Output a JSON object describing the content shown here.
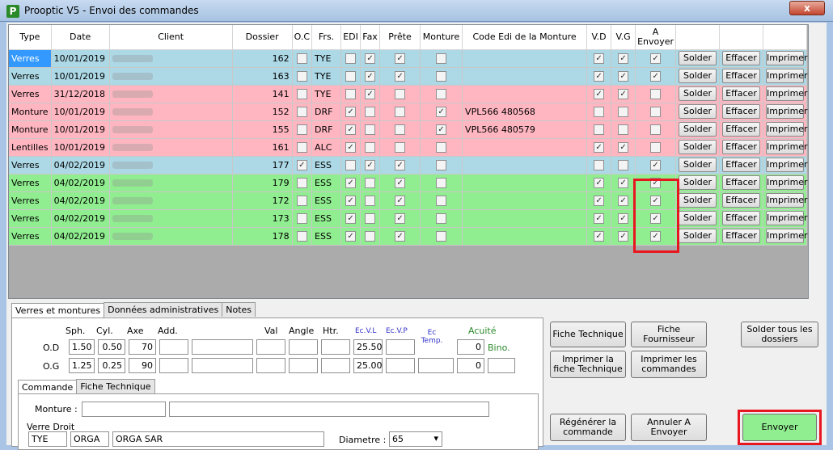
{
  "window": {
    "title": "Prooptic V5 - Envoi des commandes",
    "close": "x"
  },
  "columns": {
    "type": "Type",
    "date": "Date",
    "client": "Client",
    "dossier": "Dossier",
    "oc": "O.C",
    "frs": "Frs.",
    "edi": "EDI",
    "fax": "Fax",
    "prete": "Prête",
    "monture": "Monture",
    "code": "Code Edi de la Monture",
    "vd": "V.D",
    "vg": "V.G",
    "envoyer": "A Envoyer"
  },
  "buttons": {
    "solder": "Solder",
    "effacer": "Effacer",
    "imprimer": "Imprimer"
  },
  "rows": [
    {
      "color": "blue",
      "type": "Verres",
      "date": "10/01/2019",
      "dossier": "162",
      "oc": false,
      "frs": "TYE",
      "edi": false,
      "fax": true,
      "prete": true,
      "monture": false,
      "code": "",
      "vd": true,
      "vg": true,
      "env": true,
      "selected": true
    },
    {
      "color": "blue",
      "type": "Verres",
      "date": "10/01/2019",
      "dossier": "163",
      "oc": false,
      "frs": "TYE",
      "edi": false,
      "fax": true,
      "prete": true,
      "monture": false,
      "code": "",
      "vd": true,
      "vg": true,
      "env": true
    },
    {
      "color": "pink",
      "type": "Verres",
      "date": "31/12/2018",
      "dossier": "141",
      "oc": false,
      "frs": "TYE",
      "edi": false,
      "fax": true,
      "prete": false,
      "monture": false,
      "code": "",
      "vd": true,
      "vg": true,
      "env": false
    },
    {
      "color": "pink",
      "type": "Monture",
      "date": "10/01/2019",
      "dossier": "152",
      "oc": false,
      "frs": "DRF",
      "edi": true,
      "fax": false,
      "prete": false,
      "monture": true,
      "code": "VPL566 480568",
      "vd": false,
      "vg": false,
      "env": false
    },
    {
      "color": "pink",
      "type": "Monture",
      "date": "10/01/2019",
      "dossier": "155",
      "oc": false,
      "frs": "DRF",
      "edi": true,
      "fax": false,
      "prete": false,
      "monture": true,
      "code": "VPL566 480579",
      "vd": false,
      "vg": false,
      "env": false
    },
    {
      "color": "pink",
      "type": "Lentilles",
      "date": "10/01/2019",
      "dossier": "161",
      "oc": false,
      "frs": "ALC",
      "edi": true,
      "fax": false,
      "prete": false,
      "monture": false,
      "code": "",
      "vd": true,
      "vg": true,
      "env": false
    },
    {
      "color": "blue",
      "type": "Verres",
      "date": "04/02/2019",
      "dossier": "177",
      "oc": true,
      "frs": "ESS",
      "edi": false,
      "fax": true,
      "prete": true,
      "monture": false,
      "code": "",
      "vd": false,
      "vg": false,
      "env": true
    },
    {
      "color": "green",
      "type": "Verres",
      "date": "04/02/2019",
      "dossier": "179",
      "oc": false,
      "frs": "ESS",
      "edi": true,
      "fax": false,
      "prete": true,
      "monture": false,
      "code": "",
      "vd": true,
      "vg": true,
      "env": true
    },
    {
      "color": "green",
      "type": "Verres",
      "date": "04/02/2019",
      "dossier": "172",
      "oc": false,
      "frs": "ESS",
      "edi": true,
      "fax": false,
      "prete": true,
      "monture": false,
      "code": "",
      "vd": true,
      "vg": true,
      "env": true
    },
    {
      "color": "green",
      "type": "Verres",
      "date": "04/02/2019",
      "dossier": "173",
      "oc": false,
      "frs": "ESS",
      "edi": true,
      "fax": false,
      "prete": true,
      "monture": false,
      "code": "",
      "vd": true,
      "vg": true,
      "env": true
    },
    {
      "color": "green",
      "type": "Verres",
      "date": "04/02/2019",
      "dossier": "178",
      "oc": false,
      "frs": "ESS",
      "edi": true,
      "fax": false,
      "prete": true,
      "monture": false,
      "code": "",
      "vd": true,
      "vg": true,
      "env": true
    }
  ],
  "tabs": {
    "verres": "Verres et montures",
    "admin": "Données administratives",
    "notes": "Notes"
  },
  "rx": {
    "sph": "Sph.",
    "cyl": "Cyl.",
    "axe": "Axe",
    "add": "Add.",
    "val": "Val",
    "angle": "Angle",
    "htr": "Htr.",
    "ecvl": "Ec.V.L",
    "ecvp": "Ec.V.P",
    "ectemp": "Ec Temp.",
    "acuite": "Acuité",
    "bino": "Bino.",
    "od": {
      "label": "O.D",
      "sph": "1.50",
      "cyl": "0.50",
      "axe": "70",
      "ecvl": "25.50",
      "acuite": "0"
    },
    "og": {
      "label": "O.G",
      "sph": "1.25",
      "cyl": "0.25",
      "axe": "90",
      "ecvl": "25.00",
      "acuite": "0"
    }
  },
  "subtabs": {
    "commande": "Commande",
    "fiche": "Fiche Technique"
  },
  "commande": {
    "monture_label": "Monture :",
    "verre_droit": "Verre Droit",
    "frs": "TYE",
    "code": "ORGA",
    "desc": "ORGA SAR",
    "diametre_label": "Diametre :",
    "diametre": "65"
  },
  "actions": {
    "fiche_technique": "Fiche Technique",
    "fiche_fournisseur": "Fiche Fournisseur",
    "solder_tous": "Solder tous les dossiers",
    "imprimer_fiche": "Imprimer la fiche Technique",
    "imprimer_commandes": "Imprimer les commandes",
    "regenerer": "Régénérer la commande",
    "annuler": "Annuler A Envoyer",
    "envoyer": "Envoyer"
  }
}
